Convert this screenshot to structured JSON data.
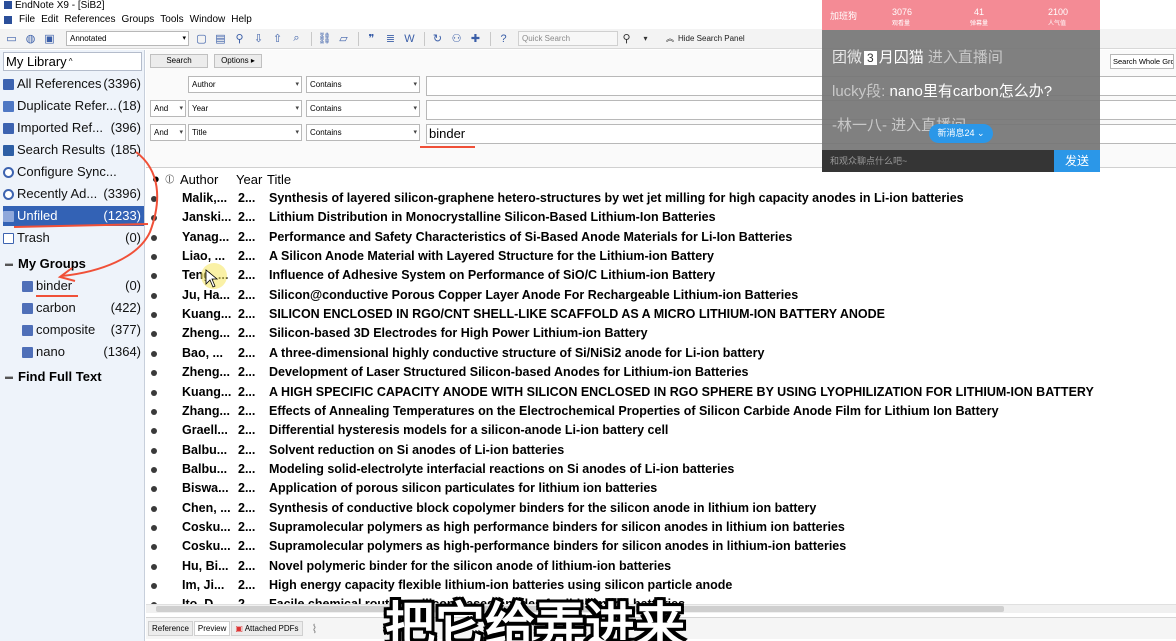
{
  "window": {
    "title": "EndNote X9 - [SiB2]",
    "menus": [
      "File",
      "Edit",
      "References",
      "Groups",
      "Tools",
      "Window",
      "Help"
    ]
  },
  "toolbar": {
    "style": "Annotated",
    "quick_search_placeholder": "Quick Search",
    "hide_search_label": "Hide Search Panel"
  },
  "library": {
    "selector": "My Library",
    "groups": [
      {
        "label": "All References",
        "count": "(3396)",
        "icon": "all-references-icon"
      },
      {
        "label": "Duplicate Refer...",
        "count": "(18)",
        "icon": "duplicate-icon"
      },
      {
        "label": "Imported Ref...",
        "count": "(396)",
        "icon": "import-icon"
      },
      {
        "label": "Search Results",
        "count": "(185)",
        "icon": "search-results-icon"
      },
      {
        "label": "Configure Sync...",
        "count": "",
        "icon": "sync-icon"
      },
      {
        "label": "Recently Ad...",
        "count": "(3396)",
        "icon": "recent-icon"
      },
      {
        "label": "Unfiled",
        "count": "(1233)",
        "icon": "unfiled-icon",
        "selected": true
      },
      {
        "label": "Trash",
        "count": "(0)",
        "icon": "trash-icon"
      }
    ],
    "my_groups_label": "My Groups",
    "my_groups": [
      {
        "label": "binder",
        "count": "(0)"
      },
      {
        "label": "carbon",
        "count": "(422)"
      },
      {
        "label": "composite",
        "count": "(377)"
      },
      {
        "label": "nano",
        "count": "(1364)"
      }
    ],
    "find_full_text_label": "Find Full Text"
  },
  "search": {
    "search_button": "Search",
    "options_button": "Options",
    "scope": "Search Whole Group",
    "rows": [
      {
        "bool": "",
        "field": "Author",
        "op": "Contains",
        "value": ""
      },
      {
        "bool": "And",
        "field": "Year",
        "op": "Contains",
        "value": ""
      },
      {
        "bool": "And",
        "field": "Title",
        "op": "Contains",
        "value": "binder"
      }
    ]
  },
  "results": {
    "columns": {
      "author": "Author",
      "year": "Year",
      "title": "Title"
    },
    "rows": [
      {
        "author": "Malik,...",
        "year": "2...",
        "title": "Synthesis of layered silicon-graphene hetero-structures by wet jet milling for high capacity anodes in Li-ion batteries"
      },
      {
        "author": "Janski...",
        "year": "2...",
        "title": "Lithium Distribution in Monocrystalline Silicon-Based Lithium-Ion Batteries"
      },
      {
        "author": "Yanag...",
        "year": "2...",
        "title": "Performance and Safety Characteristics of Si-Based Anode Materials for Li-Ion Batteries"
      },
      {
        "author": "Liao, ...",
        "year": "2...",
        "title": "A Silicon Anode Material with Layered Structure for the Lithium-ion Battery"
      },
      {
        "author": "Teng, ...",
        "year": "2...",
        "title": "Influence of Adhesive System on Performance of SiO/C Lithium-ion Battery"
      },
      {
        "author": "Ju, Ha...",
        "year": "2...",
        "title": "Silicon@conductive Porous Copper Layer Anode For Rechargeable Lithium-ion Batteries"
      },
      {
        "author": "Kuang...",
        "year": "2...",
        "title": "SILICON ENCLOSED IN RGO/CNT SHELL-LIKE SCAFFOLD AS A MICRO LITHIUM-ION BATTERY ANODE"
      },
      {
        "author": "Zheng...",
        "year": "2...",
        "title": "Silicon-based 3D Electrodes for High Power Lithium-ion Battery"
      },
      {
        "author": "Bao, ...",
        "year": "2...",
        "title": "A three-dimensional highly conductive structure of Si/NiSi2 anode for Li-ion battery"
      },
      {
        "author": "Zheng...",
        "year": "2...",
        "title": "Development of Laser Structured Silicon-based Anodes for Lithium-ion Batteries"
      },
      {
        "author": "Kuang...",
        "year": "2...",
        "title": "A HIGH SPECIFIC CAPACITY ANODE WITH SILICON ENCLOSED IN RGO SPHERE BY USING LYOPHILIZATION FOR LITHIUM-ION BATTERY"
      },
      {
        "author": "Zhang...",
        "year": "2...",
        "title": "Effects of Annealing Temperatures on the Electrochemical Properties of Silicon Carbide Anode Film for Lithium Ion Battery"
      },
      {
        "author": "Graell...",
        "year": "2...",
        "title": "Differential hysteresis models for a silicon-anode Li-ion battery cell"
      },
      {
        "author": "Balbu...",
        "year": "2...",
        "title": "Solvent reduction on Si anodes of Li-ion batteries"
      },
      {
        "author": "Balbu...",
        "year": "2...",
        "title": "Modeling solid-electrolyte interfacial reactions on Si anodes of Li-ion batteries"
      },
      {
        "author": "Biswa...",
        "year": "2...",
        "title": "Application of porous silicon particulates for lithium ion batteries"
      },
      {
        "author": "Chen, ...",
        "year": "2...",
        "title": "Synthesis of conductive block copolymer binders for the silicon anode in lithium ion battery"
      },
      {
        "author": "Cosku...",
        "year": "2...",
        "title": "Supramolecular polymers as high performance binders for silicon anodes in lithium ion batteries"
      },
      {
        "author": "Cosku...",
        "year": "2...",
        "title": "Supramolecular polymers as high-performance binders for silicon anodes in lithium-ion batteries"
      },
      {
        "author": "Hu, Bi...",
        "year": "2...",
        "title": "Novel polymeric binder for the silicon anode of lithium-ion batteries"
      },
      {
        "author": "Im, Ji...",
        "year": "2...",
        "title": "High energy capacity flexible lithium-ion batteries using silicon particle anode"
      },
      {
        "author": "Ito, D...",
        "year": "2...",
        "title": "Facile chemical route to silicon-based anodes for lithium-ion batteries"
      }
    ]
  },
  "bottom_tabs": [
    "Reference",
    "Preview",
    "Attached PDFs"
  ],
  "live_overlay": {
    "stats": [
      "加班狗",
      "3076",
      "观看量",
      "41",
      "弹幕量",
      "2100",
      "人气值"
    ],
    "messages": [
      {
        "name": "团微",
        "badge": "3",
        "text": "月囚猫",
        "suffix": "进入直播间"
      },
      {
        "name": "lucky段:",
        "text": "nano里有carbon怎么办?"
      },
      {
        "name": "-林一八-",
        "text": "进入直播间"
      }
    ],
    "new_messages": "新消息24",
    "input_placeholder": "和观众聊点什么吧~",
    "send_label": "发送"
  },
  "subtitle": "把它给弄进来",
  "colors": {
    "selected": "#3362b5",
    "annotation": "#f05038",
    "live_accent": "#f48b95",
    "send": "#2b97e8"
  }
}
